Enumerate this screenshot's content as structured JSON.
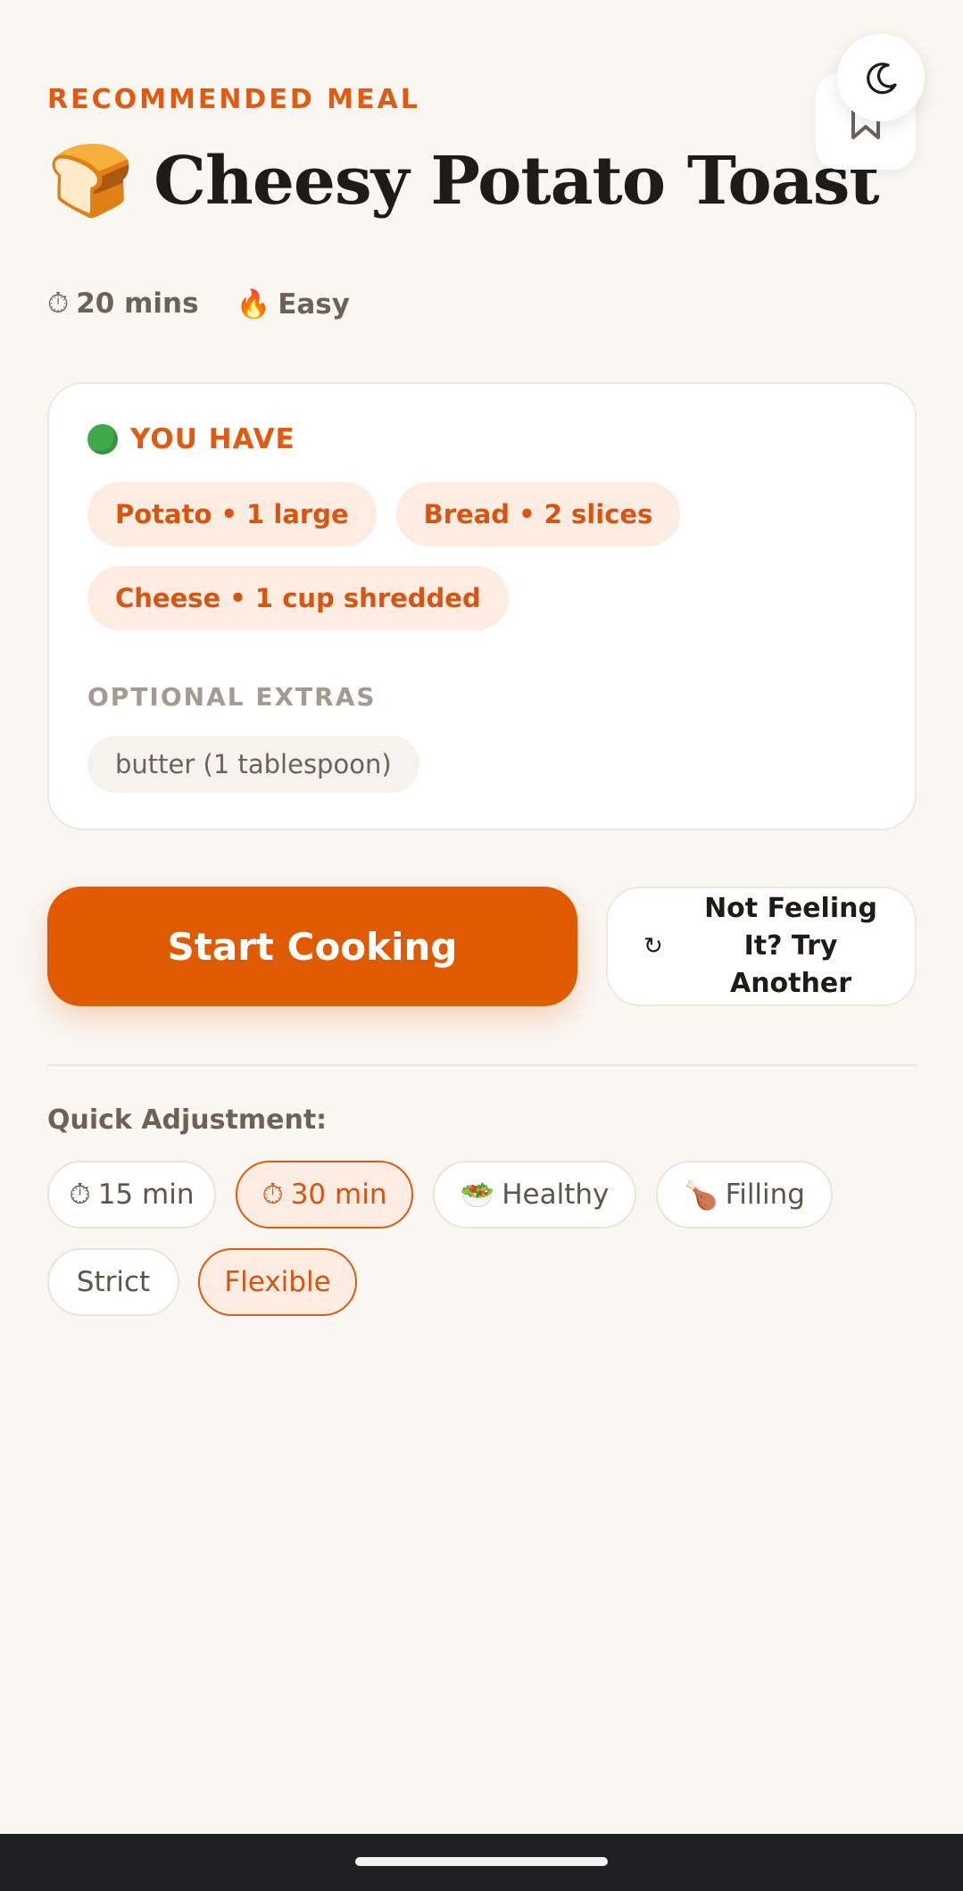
{
  "header": {
    "eyebrow": "RECOMMENDED MEAL",
    "title_emoji": "🍞",
    "title": "Cheesy Potato Toast",
    "bookmark_icon": "bookmark-icon",
    "theme_icon": "moon-icon"
  },
  "meta": {
    "time_icon": "⏱",
    "time": "20 mins",
    "difficulty_icon": "🔥",
    "difficulty": "Easy"
  },
  "ingredients_card": {
    "heading": "YOU HAVE",
    "have": [
      "Potato • 1 large",
      "Bread • 2 slices",
      "Cheese • 1 cup shredded"
    ],
    "extras_label": "OPTIONAL EXTRAS",
    "extras": [
      "butter (1 tablespoon)"
    ]
  },
  "actions": {
    "start_label": "Start Cooking",
    "refresh_icon": "↻",
    "another_label": "Not Feeling It? Try Another"
  },
  "quick_adjust": {
    "label": "Quick Adjustment:",
    "options": [
      {
        "icon": "⏱",
        "label": "15 min",
        "active": false
      },
      {
        "icon": "⏱",
        "label": "30 min",
        "active": true
      },
      {
        "icon": "🥗",
        "label": "Healthy",
        "active": false
      },
      {
        "icon": "🍗",
        "label": "Filling",
        "active": false
      },
      {
        "icon": "",
        "label": "Strict",
        "active": false
      },
      {
        "icon": "",
        "label": "Flexible",
        "active": true
      }
    ]
  },
  "colors": {
    "accent": "#e05a00",
    "chip_bg": "#fdece2",
    "background": "#faf6f1"
  }
}
